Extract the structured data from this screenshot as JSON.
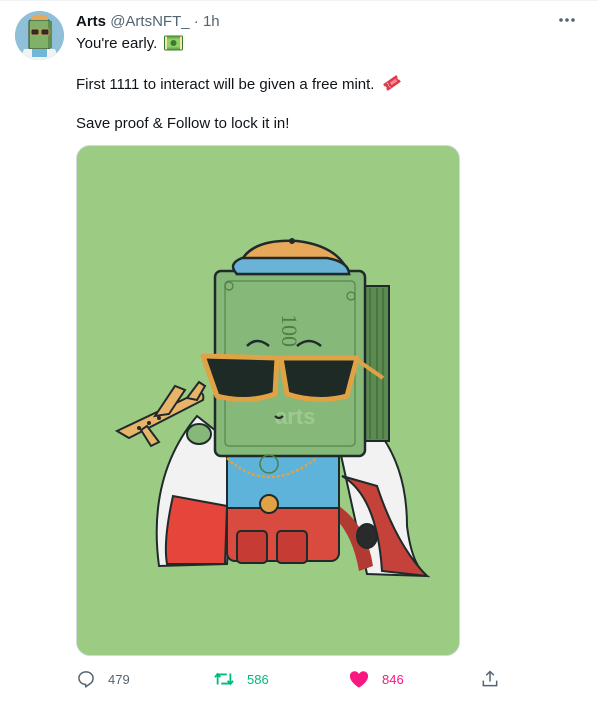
{
  "tweet": {
    "author_name": "Arts",
    "handle": "@ArtsNFT_",
    "separator": "·",
    "time": "1h",
    "lines": [
      "You're early.",
      "First 1111 to interact will be given a free mint.",
      "Save proof & Follow to lock it in!"
    ],
    "image_watermark": "arts",
    "banknote_label": "100"
  },
  "actions": {
    "replies": "479",
    "retweets": "586",
    "likes": "846"
  },
  "icons": {
    "more": "more-horizontal-icon",
    "reply": "reply-icon",
    "retweet": "retweet-icon",
    "like": "heart-filled-icon",
    "share": "share-icon",
    "money": "money-emoji-icon",
    "ticket": "ticket-emoji-icon"
  },
  "colors": {
    "retweet": "#00ba7c",
    "like": "#f91880",
    "secondary_text": "#536471",
    "image_background": "#9ccb84"
  }
}
